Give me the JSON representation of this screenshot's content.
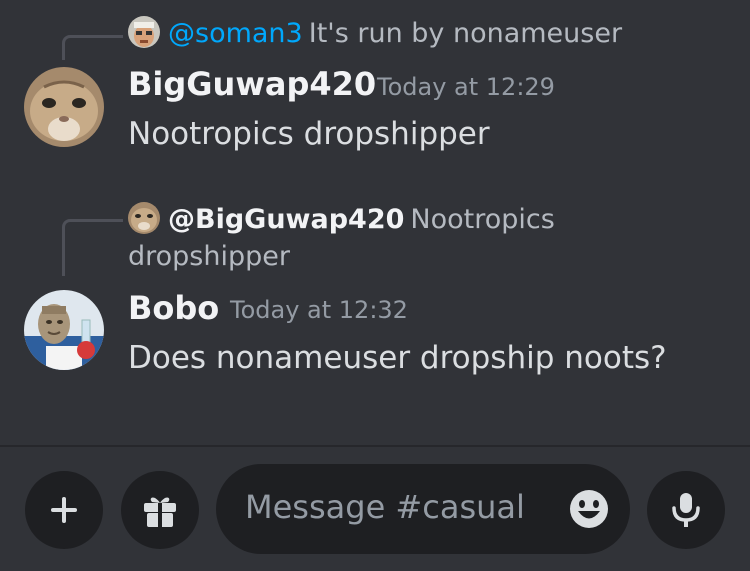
{
  "messages": [
    {
      "reply": {
        "mention": "@soman3",
        "text": "It's run by nonameuser"
      },
      "author": "BigGuwap420",
      "timestamp": "Today at 12:29",
      "content": "Nootropics dropshipper"
    },
    {
      "reply": {
        "mention": "@BigGuwap420",
        "text_line1": "Nootropics",
        "text_line2": "dropshipper"
      },
      "author": "Bobo",
      "timestamp": "Today at 12:32",
      "content": "Does nonameuser dropship noots?"
    }
  ],
  "composer": {
    "placeholder": "Message #casual",
    "add_icon": "plus-icon",
    "gift_icon": "gift-icon",
    "emoji_icon": "emoji-icon",
    "mic_icon": "microphone-icon"
  },
  "colors": {
    "background": "#313338",
    "input_background": "#1e1f22",
    "mention_blue": "#00a8fc",
    "timestamp_gray": "#949ba4"
  }
}
